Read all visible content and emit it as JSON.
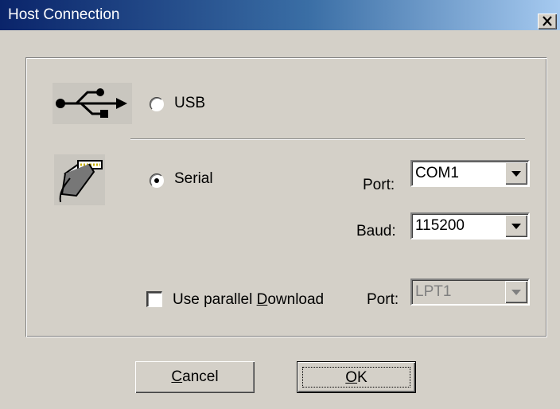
{
  "window": {
    "title": "Host Connection"
  },
  "connection": {
    "usb": {
      "label": "USB",
      "selected": false,
      "icon": "usb-icon"
    },
    "serial": {
      "label": "Serial",
      "selected": true,
      "icon": "serial-cable-icon"
    },
    "serial_port": {
      "label": "Port:",
      "value": "COM1"
    },
    "baud": {
      "label": "Baud:",
      "value": "115200"
    },
    "parallel_download": {
      "label_prefix": "Use parallel ",
      "mnemonic": "D",
      "label_suffix": "ownload",
      "checked": false
    },
    "parallel_port": {
      "label": "Port:",
      "value": "LPT1",
      "enabled": false
    }
  },
  "buttons": {
    "cancel": {
      "mnemonic": "C",
      "rest": "ancel"
    },
    "ok": {
      "mnemonic": "O",
      "rest": "K"
    }
  },
  "colors": {
    "titlebar_start": "#0a246a",
    "titlebar_end": "#a6caf0",
    "face": "#d4d0c8"
  }
}
